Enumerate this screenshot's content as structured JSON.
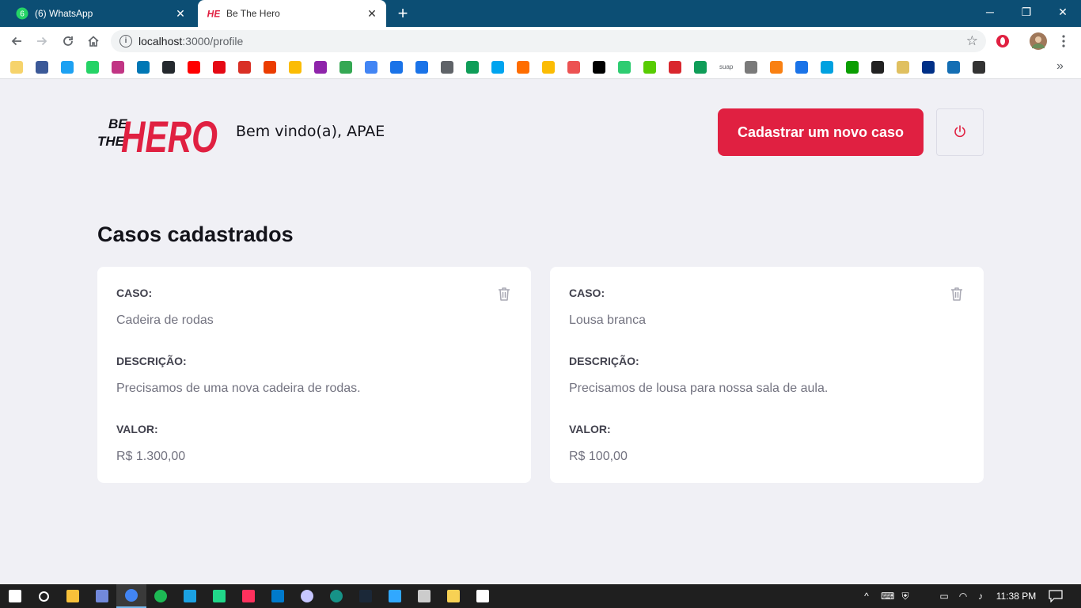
{
  "browser": {
    "tabs": [
      {
        "title": "(6) WhatsApp",
        "badge": "6",
        "active": false
      },
      {
        "title": "Be The Hero",
        "active": true
      }
    ],
    "close_glyph": "✕",
    "new_tab_glyph": "+",
    "window_controls": [
      "─",
      "❐",
      "✕"
    ],
    "url_host": "localhost",
    "url_path": ":3000/profile",
    "info_glyph": "i"
  },
  "bookmarks": {
    "icons": [
      "folder-icon",
      "facebook-icon",
      "twitter-icon",
      "whatsapp-icon",
      "instagram-icon",
      "linkedin-icon",
      "github-icon",
      "youtube-icon",
      "netflix-icon",
      "gmail-icon",
      "office-icon",
      "keep-icon",
      "app-icon",
      "photos-icon",
      "translate-icon",
      "contacts-icon",
      "messages-icon",
      "podcast-icon",
      "app-icon-2",
      "yammer-icon",
      "app-icon-3",
      "trophy-icon",
      "udemy-icon",
      "app-icon-4",
      "app-icon-5",
      "duolingo-icon",
      "mega-icon",
      "drive-icon",
      "suap-icon",
      "app-icon-6",
      "moodle-icon",
      "scholar-icon",
      "app-icon-7",
      "techcrunch-icon",
      "app-icon-8",
      "app-icon-9",
      "paypal-icon",
      "amazon-icon",
      "app-icon-10"
    ],
    "suap_label": "suap",
    "overflow_glyph": "»"
  },
  "header": {
    "logo_line1": "BE",
    "logo_line2": "THE",
    "logo_main": "HERO",
    "welcome": "Bem vindo(a), APAE",
    "new_case_label": "Cadastrar um novo caso"
  },
  "main": {
    "title": "Casos cadastrados",
    "cases": [
      {
        "case_label": "CASO:",
        "case_value": "Cadeira de rodas",
        "desc_label": "DESCRIÇÃO:",
        "desc_value": "Precisamos de uma nova cadeira de rodas.",
        "value_label": "VALOR:",
        "value_value": "R$ 1.300,00"
      },
      {
        "case_label": "CASO:",
        "case_value": "Lousa branca",
        "desc_label": "DESCRIÇÃO:",
        "desc_value": "Precisamos de lousa para nossa sala de aula.",
        "value_label": "VALOR:",
        "value_value": "R$ 100,00"
      }
    ]
  },
  "colors": {
    "brand": "#e02041",
    "background": "#f0f0f5",
    "tabstrip": "#0c4e74"
  },
  "taskbar": {
    "time": "11:38 PM",
    "pinned": [
      "start-icon",
      "search-icon",
      "file-explorer-icon",
      "discord-icon",
      "chrome-icon",
      "spotify-icon",
      "webstorm-icon",
      "pycharm-icon",
      "intellij-icon",
      "vscode-icon",
      "app-icon",
      "gitkraken-icon",
      "steam-icon",
      "photoshop-icon",
      "calculator-icon",
      "sticky-notes-icon",
      "settings-icon"
    ],
    "tray_glyphs": [
      "^",
      "⌨",
      "⛨",
      "▭",
      "◠",
      "♪"
    ]
  }
}
